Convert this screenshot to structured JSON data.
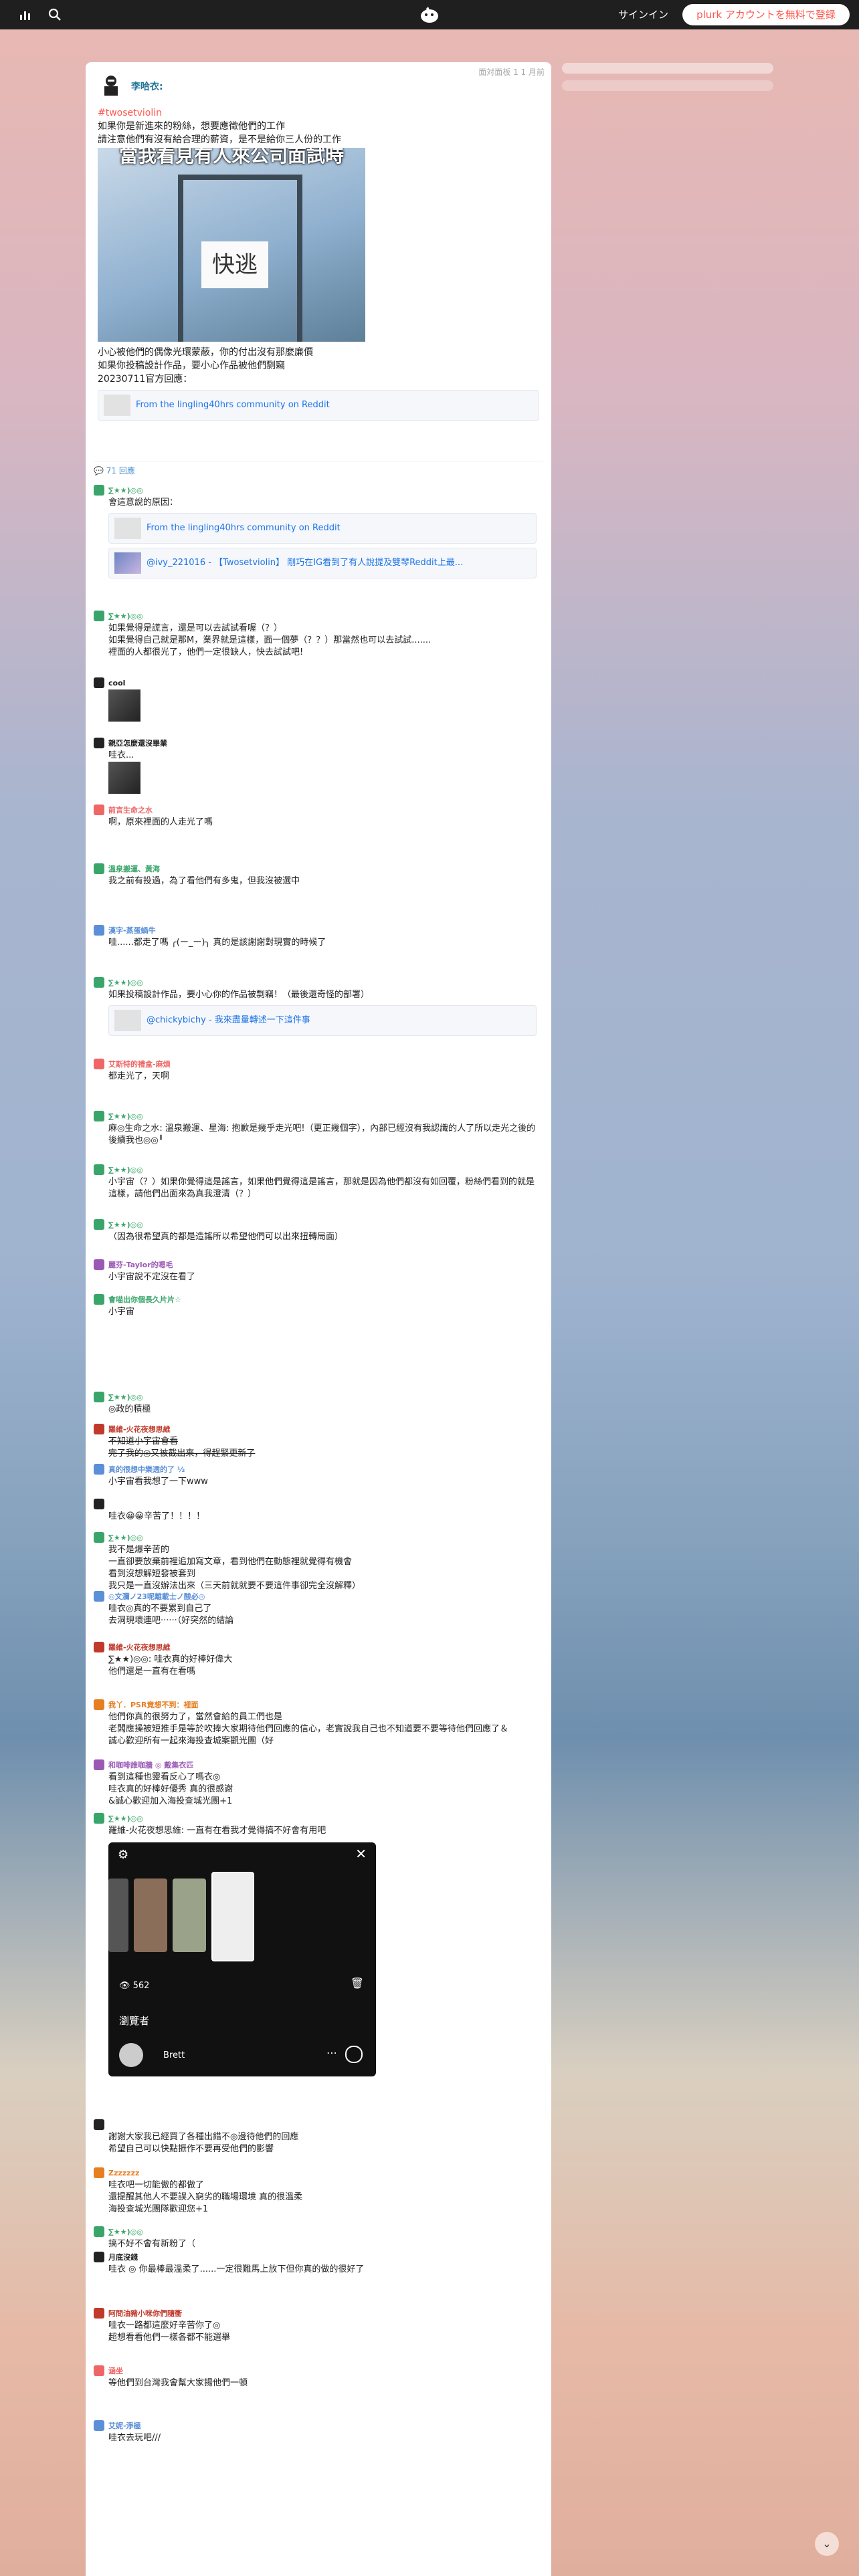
{
  "header": {
    "stats_icon": "bar-chart-icon",
    "search_icon": "search-icon",
    "logo": "plurk-logo",
    "signin": "サインイン",
    "signup": "plurk アカウントを無料で登録"
  },
  "post": {
    "owner": "李哈衣:",
    "meta": "面対面板 1 1 月前",
    "hashtag": "#twosetviolin",
    "lines": [
      "如果你是新進來的粉絲，想要應徵他們的工作",
      "請注意他們有沒有給合理的薪資，是不是給你三人份的工作"
    ],
    "meme_caption": "當我看見有人來公司面試時",
    "meme_sign": "快逃",
    "after_lines": [
      "小心被他們的偶像光環蒙蔽，你的付出沒有那麼廉價",
      "如果你投稿設計作品，要小心作品被他們剽竊",
      "20230711官方回應："
    ],
    "link": "From the lingling40hrs community on Reddit"
  },
  "responses_count": "71 回應",
  "responses": [
    {
      "name": "∑★★)◎◎",
      "color": "#3aa56b",
      "lines": [
        "會這意說的原因："
      ],
      "links": [
        "From the lingling40hrs community on Reddit",
        "@ivy_221016 - 【Twosetviolin】 剛巧在IG看到了有人說提及雙琴Reddit上最..."
      ]
    },
    {
      "name": "∑★★)◎◎",
      "color": "#3aa56b",
      "lines": [
        "如果覺得是謊言，還是可以去試試看喔（？）",
        "如果覺得自己就是那M，業界就是這樣，面一個夢（？？）那當然也可以去試試.......",
        "裡面的人都很光了，他們一定很缺人，快去試試吧!"
      ]
    },
    {
      "name": "cool",
      "color": "#222",
      "lines": []
    },
    {
      "name": "親亞怎麼還沒畢業",
      "color": "#222",
      "lines": [
        "哇衣..."
      ]
    },
    {
      "name": "前言生命之水",
      "color": "#e66",
      "lines": [
        "啊，原來裡面的人走光了嗎"
      ]
    },
    {
      "name": "溫泉搬運、黃海",
      "color": "#3aa56b",
      "lines": [
        "我之前有投過，為了看他們有多鬼，但我沒被選中"
      ]
    },
    {
      "name": "漢字-蒸蛋蝸牛",
      "color": "#5b8fd8",
      "lines": [
        "哇......都走了嗎 ╭(ー_ー)╮ 真的是該謝謝對現實的時候了"
      ]
    },
    {
      "name": "∑★★)◎◎",
      "color": "#3aa56b",
      "lines": [
        "如果投稿設計作品，要小心你的作品被剽竊！（最後還奇怪的部署）"
      ],
      "links": [
        "@chickybichy - 我來盡量轉述一下這件事"
      ]
    },
    {
      "name": "艾斯特的禮盒-麻煩",
      "color": "#e66",
      "lines": [
        "都走光了，天啊"
      ]
    },
    {
      "name": "∑★★)◎◎",
      "color": "#3aa56b",
      "lines": [
        "麻◎生命之水: 溫泉搬運、星海: 抱歉是幾乎走光吧!（更正幾個字），內部已經沒有我認識的人了所以走光之後的後續我也◎◎╹"
      ]
    },
    {
      "name": "∑★★)◎◎",
      "color": "#3aa56b",
      "lines": [
        "小宇宙（？）如果你覺得這是謠言，如果他們覺得這是謠言，那就是因為他們都沒有如回覆，粉絲們看到的就是這樣，請他們出面來為真我澄清（？）"
      ]
    },
    {
      "name": "∑★★)◎◎",
      "color": "#3aa56b",
      "lines": [
        "（因為很希望真的都是造謠所以希望他們可以出來扭轉局面）"
      ]
    },
    {
      "name": "麗芬-Taylor的嗯毛",
      "color": "#9b59b6",
      "lines": [
        "小宇宙說不定沒在看了"
      ]
    },
    {
      "name": "會喵出你個長久片片☆",
      "color": "#3aa56b",
      "lines": [
        "小宇宙"
      ]
    },
    {
      "name": "∑★★)◎◎",
      "color": "#3aa56b",
      "lines": [
        "◎政的積極"
      ]
    },
    {
      "name": "羅維-火花夜想思維",
      "color": "#c0392b",
      "lines": [
        "不知道小宇宙會看",
        "完了我的◎又被截出來，得趕緊更新了"
      ],
      "strike": true
    },
    {
      "name": "真的很想中樂透的了 ½",
      "color": "#5b8fd8",
      "lines": [
        "小宇宙看我想了一下www"
      ]
    },
    {
      "name": "",
      "color": "#222",
      "lines": [
        "哇衣😀😀辛苦了！！！！"
      ]
    },
    {
      "name": "∑★★)◎◎",
      "color": "#3aa56b",
      "lines": [
        "我不是爆辛苦的",
        "一直卻要放棄前裡追加寫文章，看到他們在動態裡就覺得有機會",
        "看到沒想解短發被套到",
        "我只是一直沒辦法出來（三天前就就要不要這件事卻完全沒解釋）"
      ]
    },
    {
      "name": "◎文瀰ノ23呢離載士ノ酸必◎",
      "color": "#5b8fd8",
      "lines": [
        "哇衣◎真的不要累到自己了",
        "去洞現壞連吧······（好突然的結論"
      ]
    },
    {
      "name": "羅維-火花夜想思維",
      "color": "#c0392b",
      "lines": [
        "∑★★)◎◎: 哇衣真的好棒好偉大",
        "他們還是一直有在看嗎"
      ]
    },
    {
      "name": "我丫．PSR竟想不到：裡面",
      "color": "#e67e22",
      "lines": [
        "他們你真的很努力了，當然會給的員工們也是",
        "老闆應操被短推手是等於吹捧大家期待他們回應的信心，老實說我自己也不知道要不要等待他們回應了＆",
        "誠心歡迎所有一起來海投查城案觀光團（好"
      ]
    },
    {
      "name": "和咖啡誰咖牆 ◎ 戴集衣匹",
      "color": "#9b59b6",
      "lines": [
        "看到這種也靈看反心了嗎衣◎",
        "哇衣真的好棒好優秀 真的很感謝",
        "&誠心歡迎加入海投查城光團+1"
      ]
    },
    {
      "name": "∑★★)◎◎",
      "color": "#3aa56b",
      "lines": [
        "羅維-火花夜想思維: 一直有在看我才覺得搞不好會有用吧"
      ],
      "viewer": {
        "count": "562",
        "title": "瀏覽者",
        "user": "Brett"
      }
    },
    {
      "name": "",
      "color": "#222",
      "lines": [
        "謝謝大家我已經買了各種出錯不◎邊待他們的回應",
        "希望自己可以快點振作不要再受他們的影響"
      ]
    },
    {
      "name": "Zzzzzzz",
      "color": "#e67e22",
      "lines": [
        "哇衣吧一切能傲的都做了",
        "還提醒其他人不要誤入窮劣的職場環境 真的很溫柔",
        "海投查城光團隊歡迎您+1"
      ]
    },
    {
      "name": "∑★★)◎◎",
      "color": "#3aa56b",
      "lines": [
        "搞不好不會有新粉了（"
      ]
    },
    {
      "name": "月底沒錢",
      "color": "#222",
      "lines": [
        "哇衣 ◎ 你最棒最溫柔了......一定很難馬上放下但你真的做的很好了"
      ]
    },
    {
      "name": "阿問油豬小咪你們隨衝",
      "color": "#c0392b",
      "lines": [
        "哇衣一路都這麼好辛苦你了◎",
        "超想看看他們一樣各都不能選舉"
      ]
    },
    {
      "name": "涵坐",
      "color": "#e66",
      "lines": [
        "等他們到台灣我會幫大家揚他們一頓"
      ]
    },
    {
      "name": "艾妮-淨極",
      "color": "#5b8fd8",
      "lines": [
        "哇衣去玩吧///"
      ]
    }
  ],
  "scroll_icon": "chevron-down-icon"
}
